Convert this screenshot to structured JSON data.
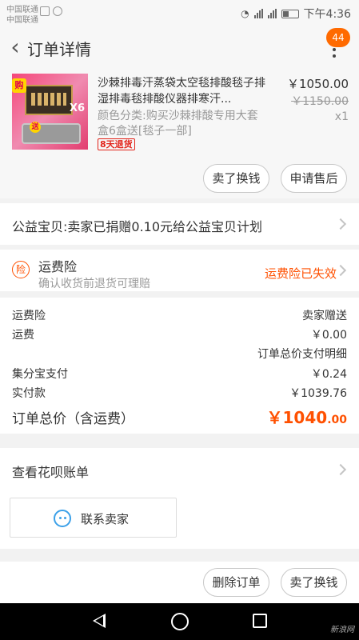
{
  "status_bar": {
    "carrier_1": "中国联通",
    "carrier_2": "中国联通",
    "time": "下午4:36"
  },
  "header": {
    "title": "订单详情",
    "message_badge": "44"
  },
  "product": {
    "title": "沙棘排毒汗蒸袋太空毯排酸毯子排湿排毒毯排酸仪器排寒汗...",
    "sku": "颜色分类:购买沙棘排酸专用大套盒6盒送[毯子一部]",
    "refund_tag": "8天退货",
    "price": "￥1050.00",
    "original_price": "￥1150.00",
    "quantity": "x1",
    "thumb_badges": {
      "buy": "购",
      "give": "送",
      "times": "X6"
    }
  },
  "product_actions": {
    "sell_button": "卖了换钱",
    "after_sale_button": "申请售后"
  },
  "charity": {
    "text": "公益宝贝:卖家已捐赠0.10元给公益宝贝计划"
  },
  "insurance": {
    "icon_text": "险",
    "title": "运费险",
    "subtitle": "确认收货前退货可理赔",
    "status": "运费险已失效"
  },
  "payment": {
    "lines": [
      {
        "label": "运费险",
        "value": "卖家赠送"
      },
      {
        "label": "运费",
        "value": "￥0.00"
      },
      {
        "label": "",
        "value": "订单总价支付明细"
      },
      {
        "label": "集分宝支付",
        "value": "￥0.24"
      },
      {
        "label": "实付款",
        "value": "￥1039.76"
      }
    ],
    "total_label": "订单总价（含运费）",
    "total_integer": "￥1040",
    "total_decimal": ".00"
  },
  "huabei": {
    "text": "查看花呗账单"
  },
  "contact": {
    "label": "联系卖家"
  },
  "bottom_actions": {
    "delete_button": "删除订单",
    "sell_button": "卖了换钱"
  },
  "watermark": "新浪网"
}
